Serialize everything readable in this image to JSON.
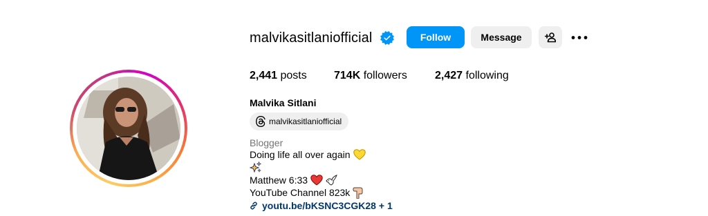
{
  "profile": {
    "username": "malvikasitlaniofficial",
    "verified": true,
    "full_name": "Malvika Sitlani",
    "threads_handle": "malvikasitlaniofficial",
    "category": "Blogger"
  },
  "actions": {
    "follow_label": "Follow",
    "message_label": "Message"
  },
  "stats": {
    "posts_count": "2,441",
    "posts_label": "posts",
    "followers_count": "714K",
    "followers_label": "followers",
    "following_count": "2,427",
    "following_label": "following"
  },
  "bio": {
    "line1": "Doing life all over again",
    "line1_emoji": "yellow-heart-icon",
    "line2_emoji": "sparkles-icon",
    "line3": "Matthew 6:33",
    "line3_emojis": [
      "red-heart-icon",
      "dove-icon"
    ],
    "line4": "YouTube Channel 823k",
    "line4_emoji": "pointing-down-icon"
  },
  "link": {
    "text": "youtu.be/bKSNC3CGK28",
    "extra": "+ 1"
  },
  "colors": {
    "follow_button": "#0095f6",
    "secondary_button": "#efefef",
    "link": "#00376b",
    "category": "#737373",
    "verified_badge": "#0095f6"
  }
}
